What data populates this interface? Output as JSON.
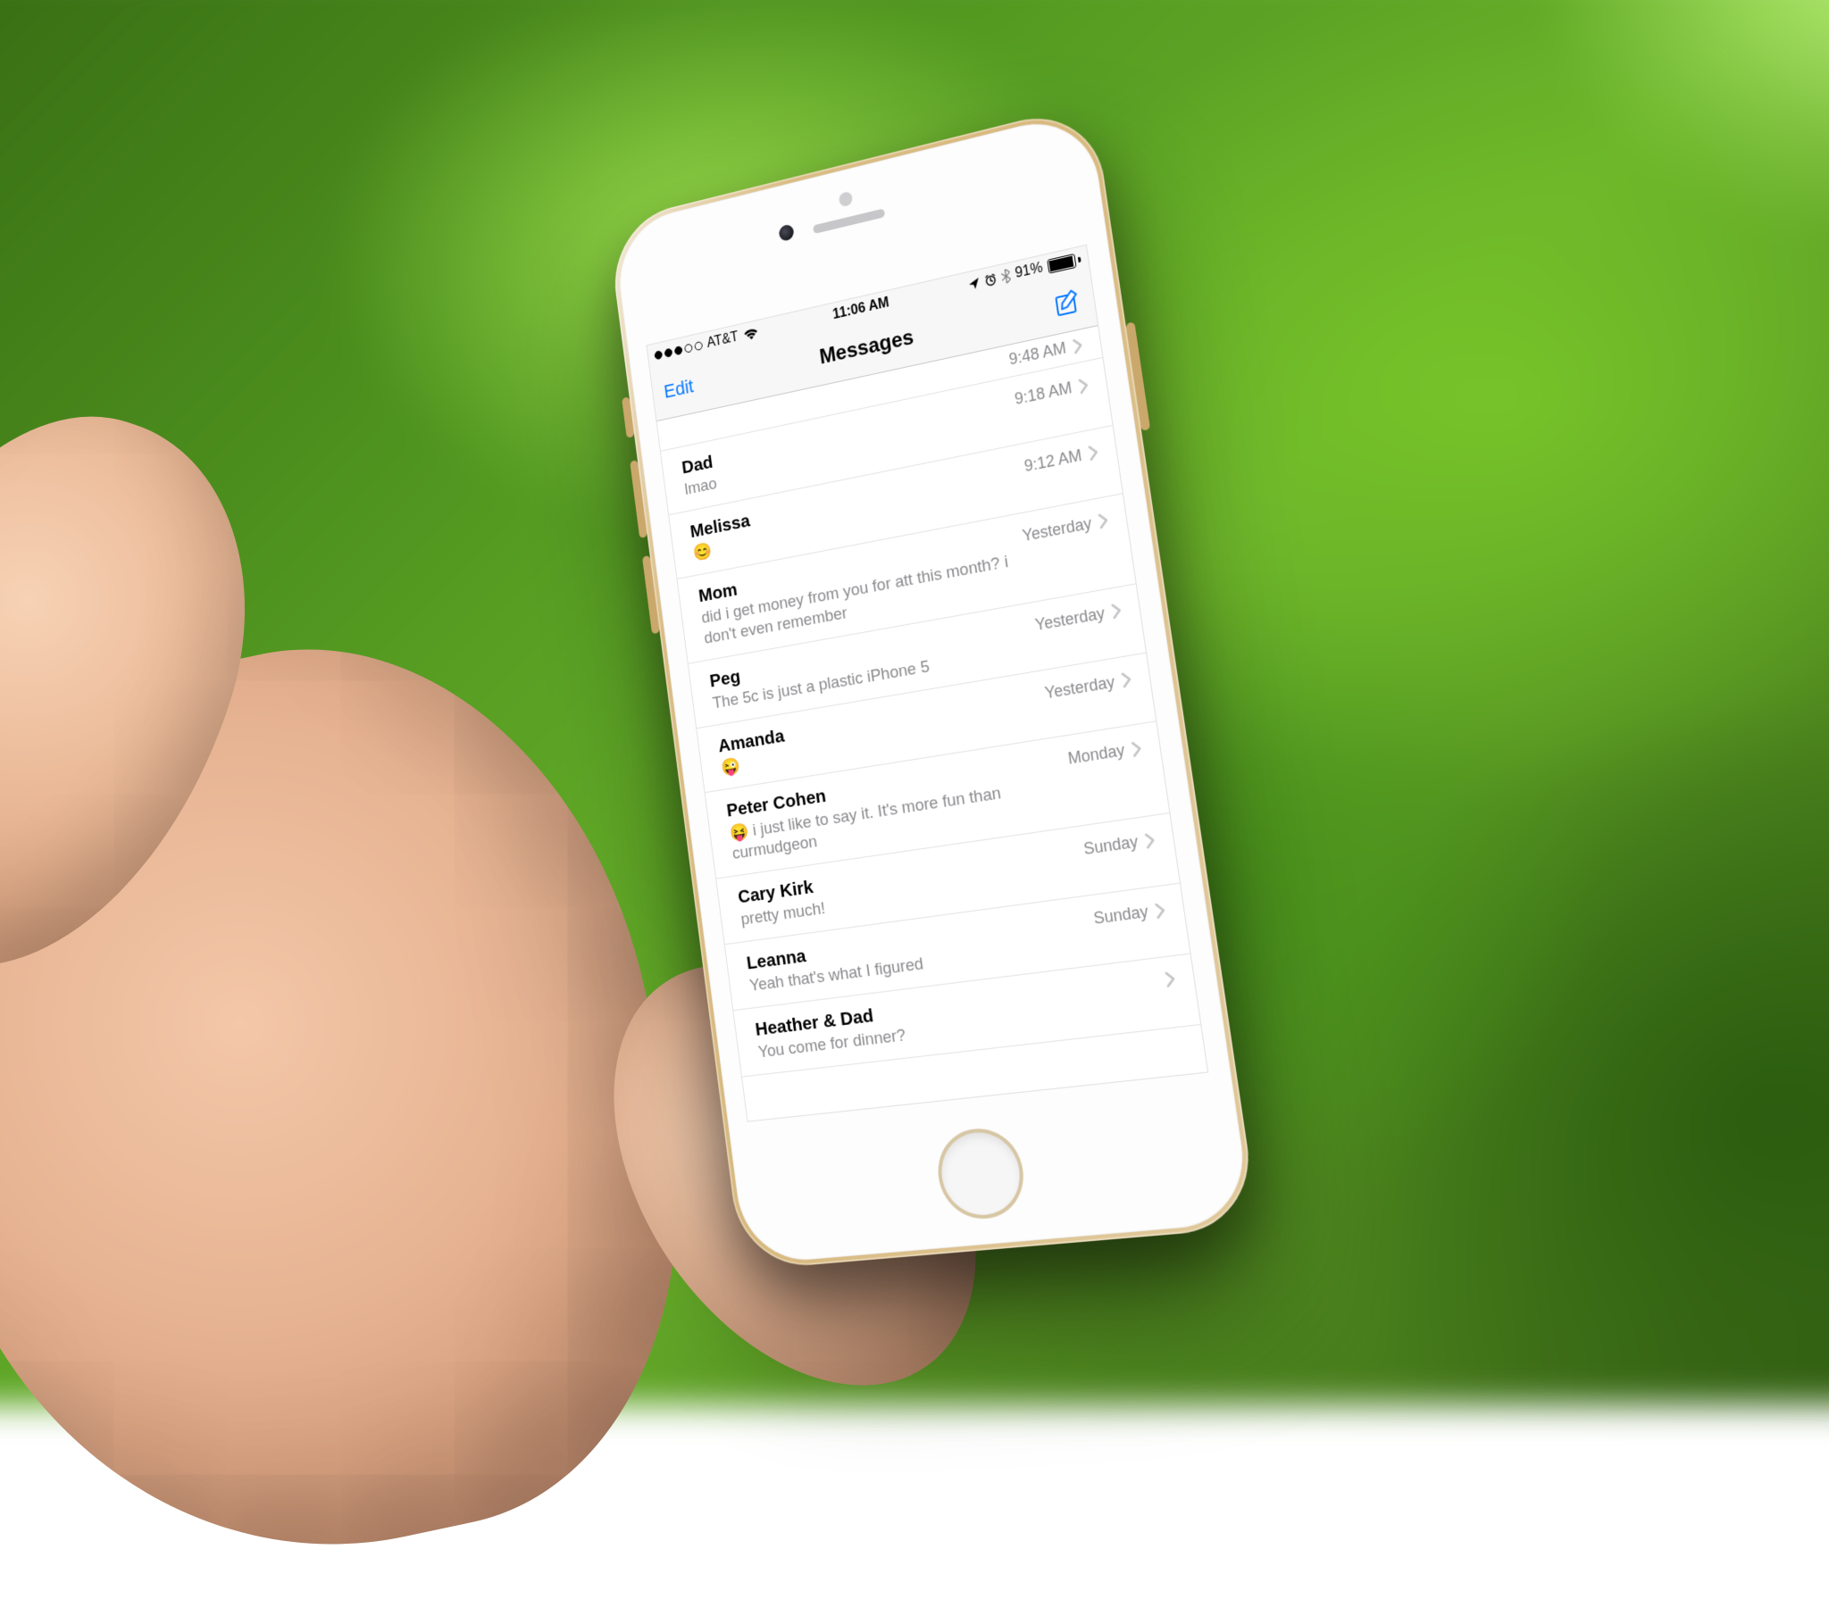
{
  "status": {
    "carrier": "AT&T",
    "time": "11:06 AM",
    "battery_pct": "91%"
  },
  "nav": {
    "edit": "Edit",
    "title": "Messages"
  },
  "peek_time": "9:48 AM",
  "threads": [
    {
      "name": "Dad",
      "preview": "lmao",
      "time": "9:18 AM"
    },
    {
      "name": "Melissa",
      "preview": "😊",
      "time": "9:12 AM"
    },
    {
      "name": "Mom",
      "preview": "did i get money from you for att this month? i don't even remember",
      "time": "Yesterday"
    },
    {
      "name": "Peg",
      "preview": "The 5c is just a plastic iPhone 5",
      "time": "Yesterday"
    },
    {
      "name": "Amanda",
      "preview": "😜",
      "time": "Yesterday"
    },
    {
      "name": "Peter Cohen",
      "preview": "😝 i just like to say it. It's more fun than curmudgeon",
      "time": "Monday"
    },
    {
      "name": "Cary Kirk",
      "preview": "pretty much!",
      "time": "Sunday"
    },
    {
      "name": "Leanna",
      "preview": "Yeah that's what I figured",
      "time": "Sunday"
    },
    {
      "name": "Heather & Dad",
      "preview": "You come for dinner?",
      "time": ""
    }
  ]
}
